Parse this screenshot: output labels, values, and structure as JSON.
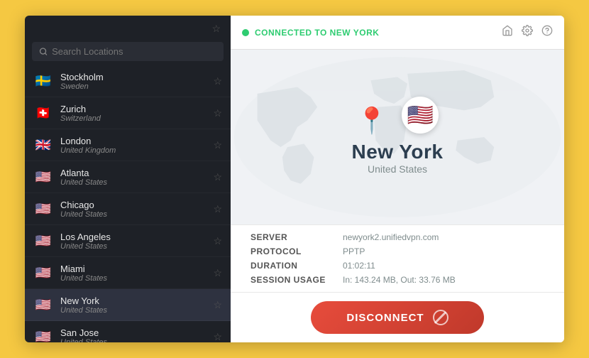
{
  "sidebar": {
    "star_label": "★",
    "search_placeholder": "Search Locations",
    "locations": [
      {
        "id": "stockholm",
        "name": "Stockholm",
        "country": "Sweden",
        "flag": "🇸🇪",
        "starred": false,
        "active": false
      },
      {
        "id": "zurich",
        "name": "Zurich",
        "country": "Switzerland",
        "flag": "🇨🇭",
        "starred": false,
        "active": false
      },
      {
        "id": "london",
        "name": "London",
        "country": "United Kingdom",
        "flag": "🇬🇧",
        "starred": false,
        "active": false
      },
      {
        "id": "atlanta",
        "name": "Atlanta",
        "country": "United States",
        "flag": "🇺🇸",
        "starred": false,
        "active": false
      },
      {
        "id": "chicago",
        "name": "Chicago",
        "country": "United States",
        "flag": "🇺🇸",
        "starred": false,
        "active": false
      },
      {
        "id": "los-angeles",
        "name": "Los Angeles",
        "country": "United States",
        "flag": "🇺🇸",
        "starred": false,
        "active": false
      },
      {
        "id": "miami",
        "name": "Miami",
        "country": "United States",
        "flag": "🇺🇸",
        "starred": false,
        "active": false
      },
      {
        "id": "new-york",
        "name": "New York",
        "country": "United States",
        "flag": "🇺🇸",
        "starred": false,
        "active": true
      },
      {
        "id": "san-jose",
        "name": "San Jose",
        "country": "United States",
        "flag": "🇺🇸",
        "starred": false,
        "active": false
      }
    ]
  },
  "topbar": {
    "status": "CONNECTED TO NEW YORK",
    "home_icon": "⌂",
    "settings_icon": "⚙",
    "help_icon": "?"
  },
  "main": {
    "city": "New York",
    "country": "United States",
    "flag": "🇺🇸",
    "server_label": "SERVER",
    "server_value": "newyork2.unifiedvpn.com",
    "protocol_label": "PROTOCOL",
    "protocol_value": "PPTP",
    "duration_label": "DURATION",
    "duration_value": "01:02:11",
    "session_label": "SESSION USAGE",
    "session_value": "In: 143.24 MB, Out: 33.76 MB",
    "disconnect_label": "DISCONNECT"
  }
}
